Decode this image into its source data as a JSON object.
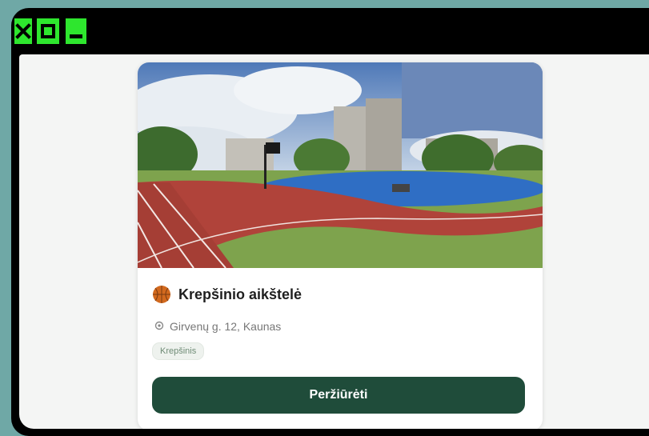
{
  "window_controls": {
    "close_icon": "close-icon",
    "maximize_icon": "maximize-icon",
    "minimize_icon": "minimize-icon",
    "color": "#2ee62e"
  },
  "card": {
    "icon": "basketball-icon",
    "title": "Krepšinio aikštelė",
    "address_icon": "location-pin-icon",
    "address": "Girvenų g. 12, Kaunas",
    "tag": "Krepšinis",
    "button_label": "Peržiūrėti",
    "button_color": "#1f4c3a"
  }
}
